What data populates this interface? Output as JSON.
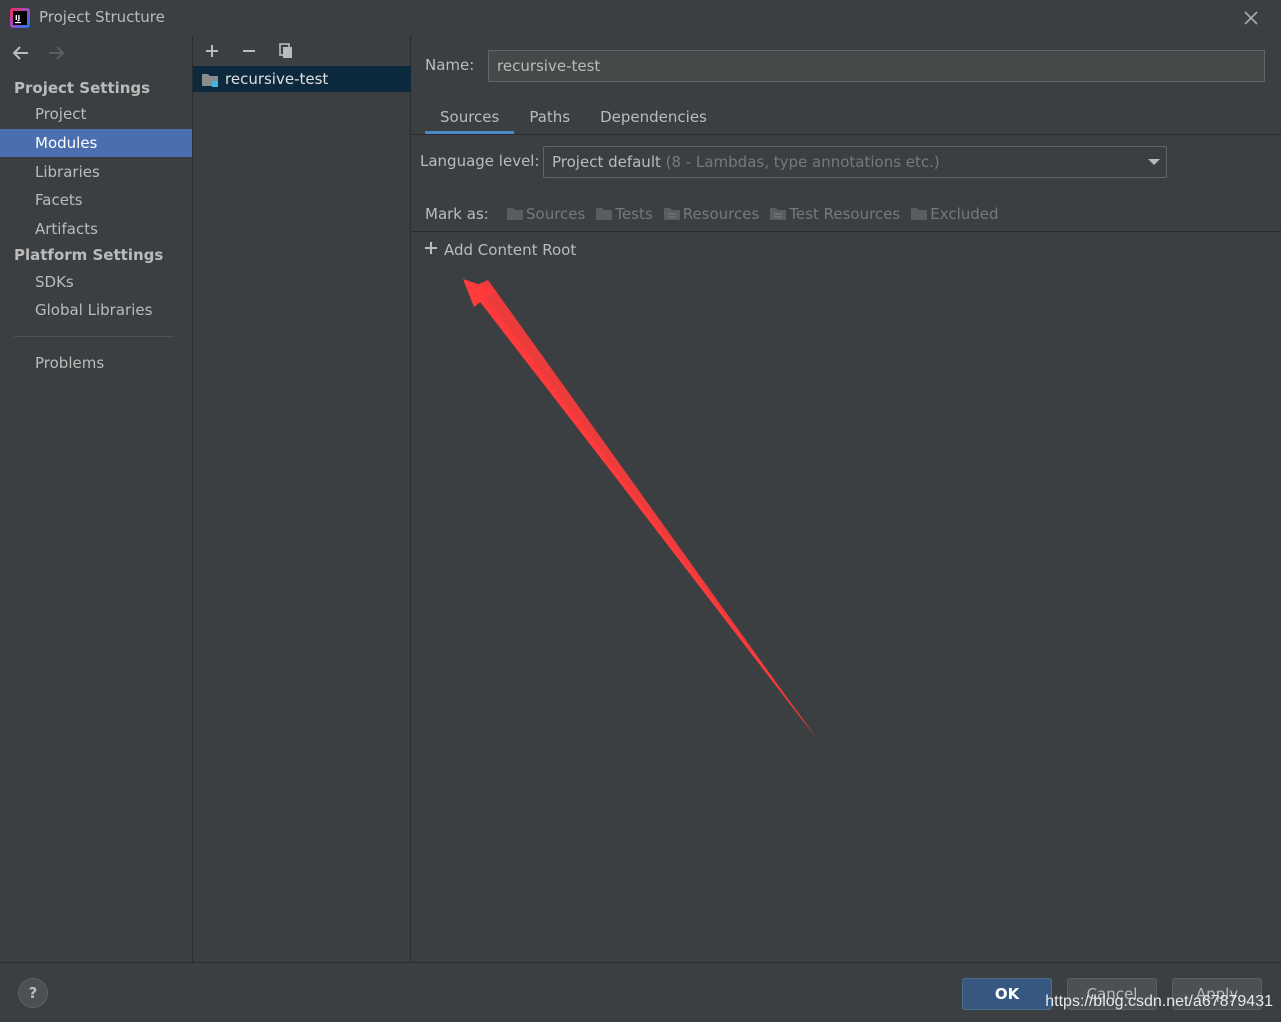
{
  "window": {
    "title": "Project Structure",
    "icon": "intellij-app-icon"
  },
  "nav": {
    "back_icon": "arrow-left-icon",
    "forward_icon": "arrow-right-icon",
    "project_settings_heading": "Project Settings",
    "project_settings_items": [
      "Project",
      "Modules",
      "Libraries",
      "Facets",
      "Artifacts"
    ],
    "selected_item": "Modules",
    "platform_settings_heading": "Platform Settings",
    "platform_settings_items": [
      "SDKs",
      "Global Libraries"
    ],
    "problems_label": "Problems"
  },
  "modules": {
    "toolbar": [
      "plus-icon",
      "minus-icon",
      "copy-icon"
    ],
    "items": [
      "recursive-test"
    ]
  },
  "module_detail": {
    "name_label": "Name:",
    "name_value": "recursive-test",
    "tabs": [
      "Sources",
      "Paths",
      "Dependencies"
    ],
    "active_tab": "Sources",
    "language_level_label": "Language level:",
    "language_level_value": "Project default",
    "language_level_hint": "(8 - Lambdas, type annotations etc.)",
    "mark_as_label": "Mark as:",
    "mark_as_items": [
      "Sources",
      "Tests",
      "Resources",
      "Test Resources",
      "Excluded"
    ],
    "add_content_root": "Add Content Root"
  },
  "footer": {
    "help": "?",
    "ok": "OK",
    "cancel": "Cancel",
    "apply": "Apply",
    "watermark": "https://blog.csdn.net/a67879431"
  },
  "colors": {
    "background": "#3c3f41",
    "selection": "#4b6eaf",
    "module_selection": "#0d293e",
    "ok_button": "#365880",
    "annotation_arrow": "#ff3b3b"
  }
}
